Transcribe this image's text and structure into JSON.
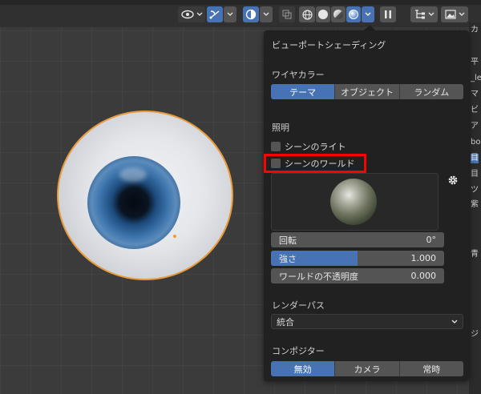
{
  "popover": {
    "title": "ビューポートシェーディング",
    "wire_color": {
      "label": "ワイヤカラー",
      "options": [
        "テーマ",
        "オブジェクト",
        "ランダム"
      ],
      "active": 0
    },
    "lighting": {
      "label": "照明",
      "scene_lights_label": "シーンのライト",
      "scene_world_label": "シーンのワールド"
    },
    "rotation": {
      "label": "回転",
      "value": "0°"
    },
    "strength": {
      "label": "強さ",
      "value": "1.000",
      "fill_fraction": 0.5
    },
    "world_opacity": {
      "label": "ワールドの不透明度",
      "value": "0.000"
    },
    "render_pass": {
      "label": "レンダーパス",
      "selected": "統合"
    },
    "compositor": {
      "label": "コンポジター",
      "options": [
        "無効",
        "カメラ",
        "常時"
      ],
      "active": 0
    }
  },
  "right_strip": {
    "chars": [
      "カ",
      "平",
      "_le",
      "マ",
      "ビ",
      "ア",
      "bo",
      "目",
      "目",
      "ツ",
      "紫",
      "青",
      "ジ"
    ]
  },
  "colors": {
    "accent": "#4772b3",
    "highlight": "#ff0000",
    "selection_outline": "#e89a3a"
  },
  "icons": [
    "eye-icon",
    "gizmo-icon",
    "overlay-icon",
    "xray-icon",
    "wireframe-shading-icon",
    "solid-shading-icon",
    "material-shading-icon",
    "rendered-shading-icon",
    "pause-icon",
    "editor-type-icon",
    "display-mode-icon",
    "gear-icon",
    "chevron-down-icon"
  ]
}
